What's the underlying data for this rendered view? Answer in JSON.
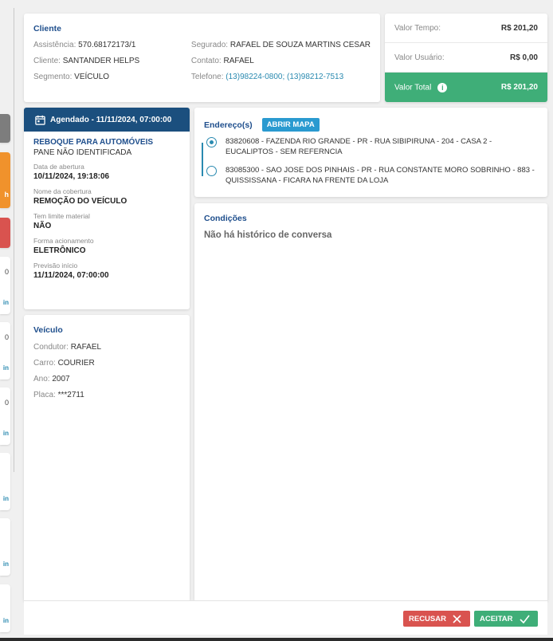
{
  "cliente": {
    "title": "Cliente",
    "assistencia_label": "Assistência:",
    "assistencia": "570.68172173/1",
    "cliente_label": "Cliente:",
    "cliente": "SANTANDER HELPS",
    "segmento_label": "Segmento:",
    "segmento": "VEÍCULO",
    "segurado_label": "Segurado:",
    "segurado": "RAFAEL DE SOUZA MARTINS CESAR",
    "contato_label": "Contato:",
    "contato": "RAFAEL",
    "telefone_label": "Telefone:",
    "telefone": "(13)98224-0800; (13)98212-7513"
  },
  "valores": {
    "tempo_label": "Valor Tempo:",
    "tempo": "R$ 201,20",
    "usuario_label": "Valor Usuário:",
    "usuario": "R$ 0,00",
    "total_label": "Valor Total",
    "total": "R$ 201,20"
  },
  "agendado": {
    "header": "Agendado - 11/11/2024, 07:00:00",
    "title": "REBOQUE PARA AUTOMÓVEIS",
    "subtitle": "PANE NÃO IDENTIFICADA",
    "fields": [
      {
        "label": "Data de abertura",
        "value": "10/11/2024, 19:18:06"
      },
      {
        "label": "Nome da cobertura",
        "value": "REMOÇÃO DO VEÍCULO"
      },
      {
        "label": "Tem limite material",
        "value": "NÃO"
      },
      {
        "label": "Forma acionamento",
        "value": "ELETRÔNICO"
      },
      {
        "label": "Previsão início",
        "value": "11/11/2024, 07:00:00"
      }
    ]
  },
  "veiculo": {
    "title": "Veículo",
    "condutor_label": "Condutor:",
    "condutor": "RAFAEL",
    "carro_label": "Carro:",
    "carro": "COURIER",
    "ano_label": "Ano:",
    "ano": "2007",
    "placa_label": "Placa:",
    "placa": "***2711"
  },
  "endereco": {
    "title": "Endereço(s)",
    "map_button": "ABRIR MAPA",
    "addresses": [
      "83820608 - FAZENDA RIO GRANDE - PR - RUA SIBIPIRUNA - 204 - CASA 2 - EUCALIPTOS - SEM REFERNCIA",
      "83085300 - SAO JOSE DOS PINHAIS - PR - RUA CONSTANTE MORO SOBRINHO - 883 - QUISSISSANA - FICARA NA FRENTE DA LOJA"
    ]
  },
  "condicoes": {
    "title": "Condições",
    "empty": "Não há histórico de conversa"
  },
  "actions": {
    "recusar": "RECUSAR",
    "aceitar": "ACEITAR"
  },
  "sidebar_partial": {
    "numbers": [
      "0",
      "0",
      "0"
    ],
    "links": [
      "in",
      "in",
      "in",
      "in",
      "in",
      "in"
    ],
    "orange_text": "h"
  },
  "colors": {
    "primary": "#1b4f7e",
    "accent": "#2a9ad0",
    "success": "#3fae78",
    "danger": "#d9534f"
  }
}
